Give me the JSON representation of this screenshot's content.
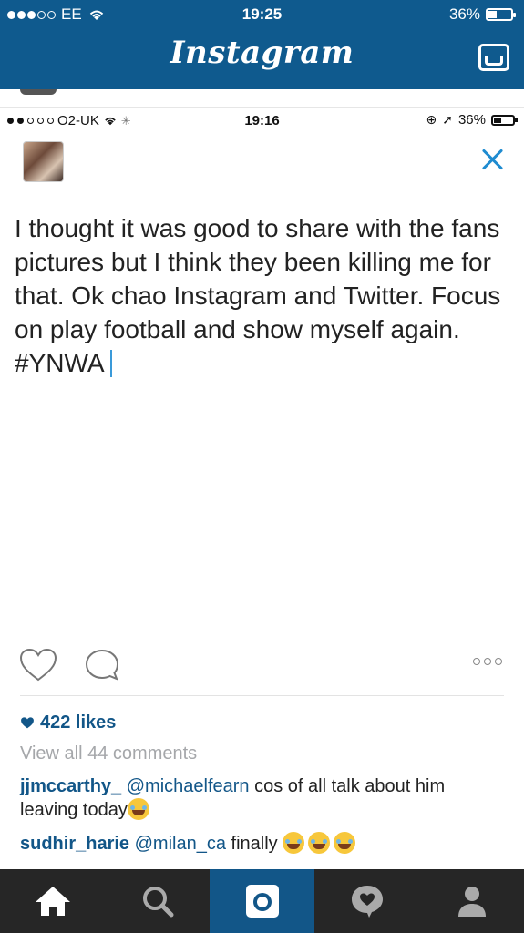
{
  "outer_status": {
    "carrier": "EE",
    "time": "19:25",
    "battery": "36%",
    "signal_bars": 3,
    "battery_level": 0.36
  },
  "header": {
    "title": "Instagram",
    "inbox_icon": "inbox-icon"
  },
  "inner_status": {
    "carrier": "O2-UK",
    "time": "19:16",
    "battery": "36%",
    "signal_bars": 2,
    "battery_level": 0.36
  },
  "post": {
    "text": "I thought it was good to share with the fans pictures but I think they been killing me for that. Ok chao Instagram and Twitter. Focus on play football and show myself again. #YNWA",
    "close_icon": "close-icon"
  },
  "actions": {
    "like_icon": "heart-outline-icon",
    "comment_icon": "comment-bubble-icon",
    "more_icon": "more-options-icon"
  },
  "likes": "422 likes",
  "view_comments": "View all 44 comments",
  "comments": [
    {
      "user": "jjmccarthy_",
      "mention": "@michaelfearn",
      "text": " cos of all talk about him leaving today"
    },
    {
      "user": "sudhir_harie",
      "mention": "@milan_ca",
      "text": " finally"
    }
  ],
  "nav": {
    "items": [
      "home-icon",
      "search-icon",
      "camera-icon",
      "activity-icon",
      "profile-icon"
    ],
    "active": "camera-icon"
  },
  "colors": {
    "header_bg": "#0f5a8e",
    "link": "#125688",
    "close_blue": "#1e8bd0",
    "nav_bg": "#262626",
    "nav_active": "#125688"
  }
}
